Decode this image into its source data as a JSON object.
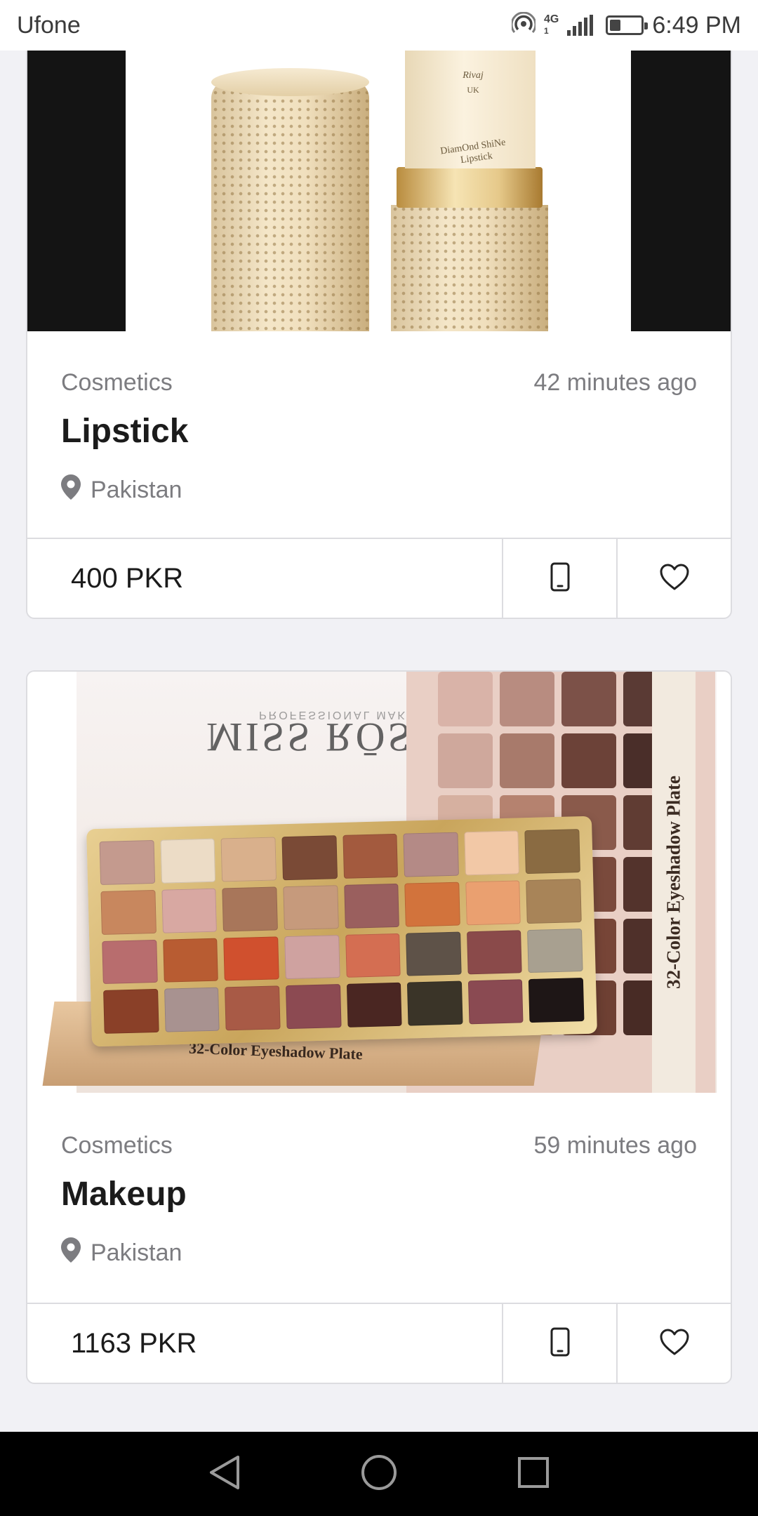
{
  "status_bar": {
    "carrier": "Ufone",
    "network_superscript": "1",
    "network_type": "4G",
    "network_sub": "1",
    "battery_level": 0.35,
    "time": "6:49 PM"
  },
  "listings": [
    {
      "category": "Cosmetics",
      "time_ago": "42 minutes ago",
      "title": "Lipstick",
      "location": "Pakistan",
      "price": "400 PKR",
      "image_text": [
        "Rivaj",
        "UK",
        "DiamOnd ShiNe",
        "Lipstick"
      ]
    },
    {
      "category": "Cosmetics",
      "time_ago": "59 minutes ago",
      "title": "Makeup",
      "location": "Pakistan",
      "price": "1163 PKR",
      "image_text": [
        "MISS RŌSE",
        "PROFESSIONAL MAKE UP",
        "32-Color Eyeshadow Plate",
        "32-Color Eyeshadow Plate"
      ]
    }
  ],
  "icons": {
    "location": "location-pin-icon",
    "phone": "phone-icon",
    "favorite": "heart-icon",
    "back": "back-triangle-icon",
    "home": "home-circle-icon",
    "recents": "recents-square-icon"
  },
  "colors": {
    "background": "#f1f1f5",
    "card": "#ffffff",
    "border": "#dcdce0",
    "text_primary": "#1b1b1b",
    "text_secondary": "#7c7c80",
    "nav_bar": "#000000"
  }
}
